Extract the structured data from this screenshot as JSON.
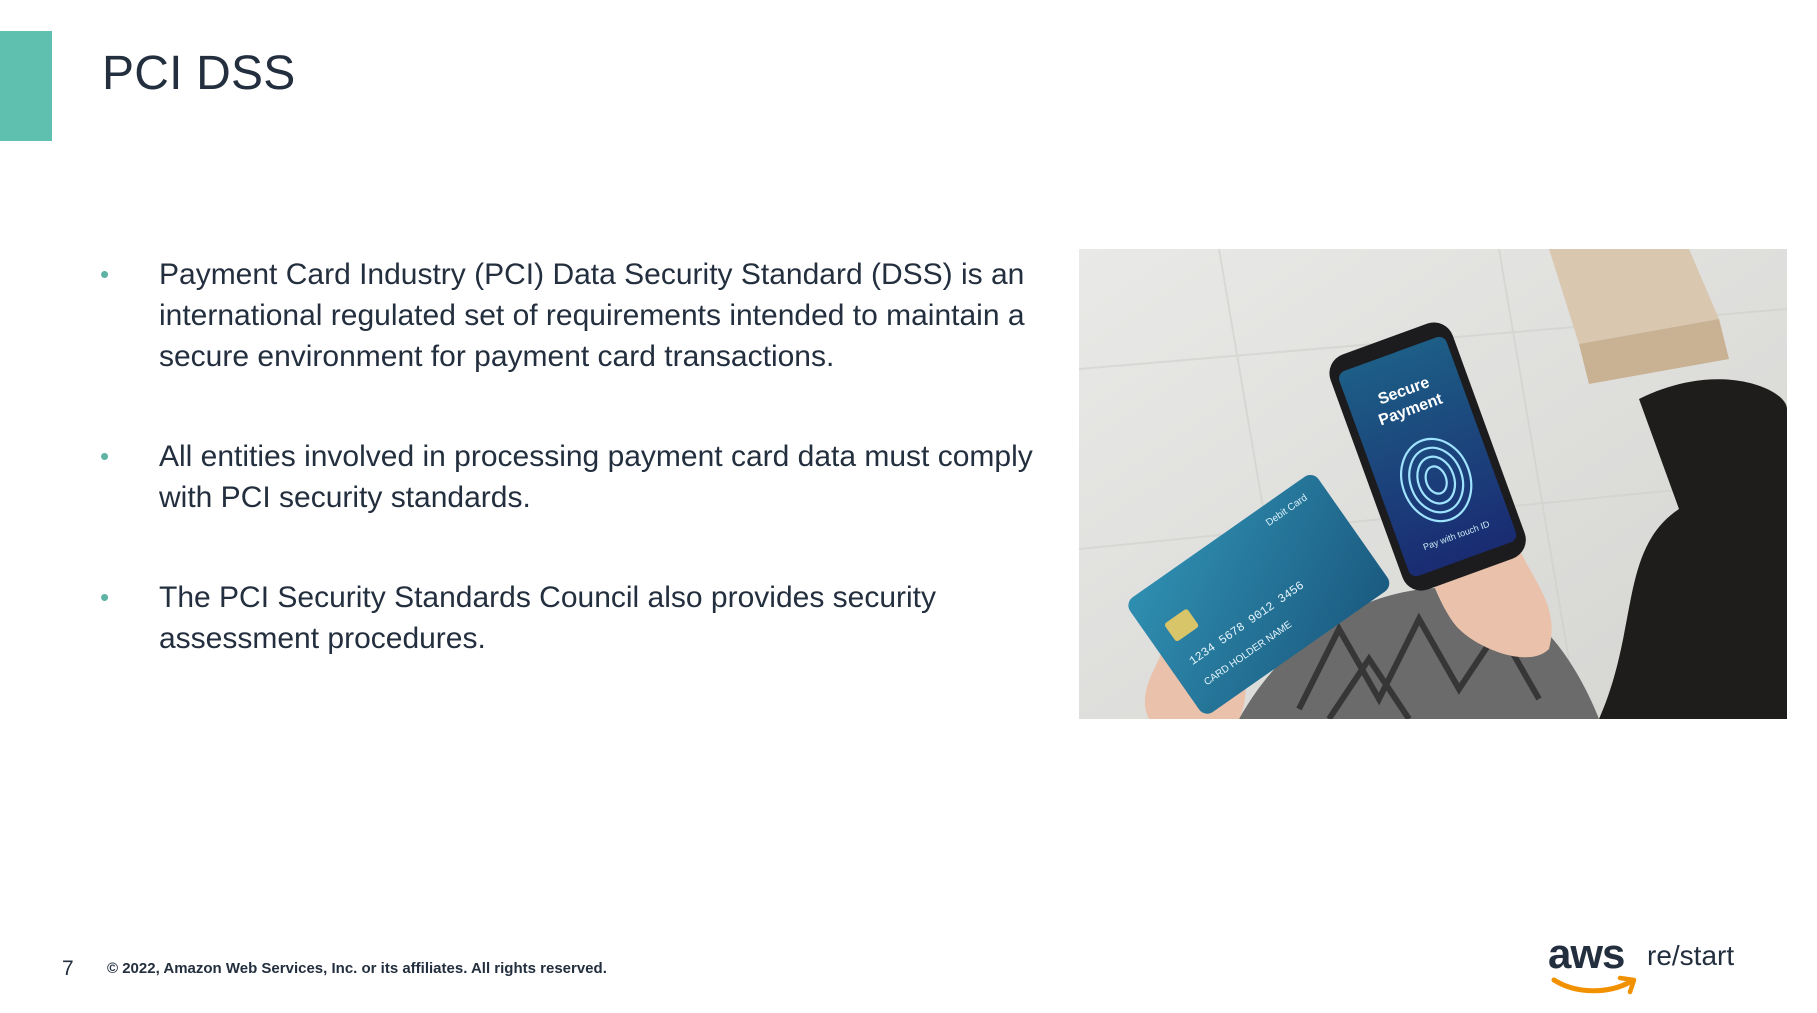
{
  "slide": {
    "title": "PCI DSS",
    "bullets": [
      "Payment Card Industry (PCI) Data Security Standard (DSS) is an international regulated set of requirements intended to maintain a secure environment for payment card transactions.",
      "All entities involved in processing payment card data must comply with PCI security standards.",
      "The PCI Security Standards Council also provides security assessment procedures."
    ],
    "bullet_marker": "•"
  },
  "photo": {
    "phone_screen_line1": "Secure",
    "phone_screen_line2": "Payment",
    "phone_screen_caption": "Pay with touch ID",
    "card_label": "Debit Card",
    "card_number": "1234 5678 9012 3456",
    "card_holder": "CARD HOLDER NAME"
  },
  "footer": {
    "page_number": "7",
    "copyright": "© 2022, Amazon Web Services, Inc. or its affiliates. All rights reserved."
  },
  "logo": {
    "aws": "aws",
    "restart": "re/start"
  },
  "colors": {
    "accent": "#5fc0b0",
    "text": "#232f3e",
    "bullet": "#5fb3a4",
    "aws_smile": "#f29100"
  }
}
